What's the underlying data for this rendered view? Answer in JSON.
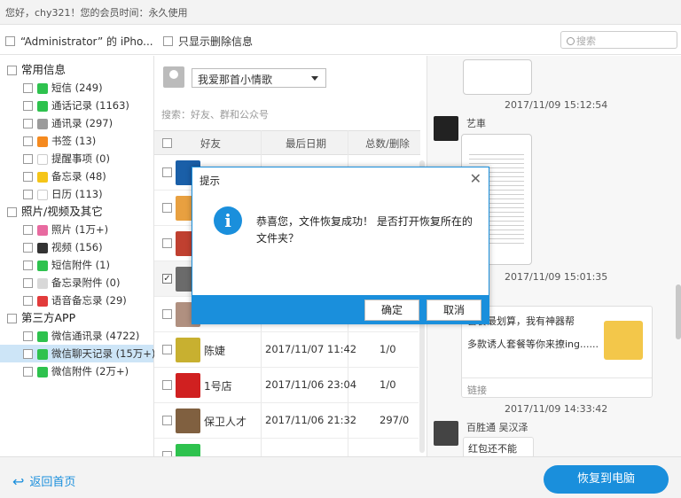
{
  "topbar": {
    "greeting": "您好，chy321！您的会员时间：永久使用"
  },
  "toolbar": {
    "device_label": "“Administrator” 的 iPho...",
    "only_deleted_label": "只显示删除信息",
    "search_placeholder": "搜索"
  },
  "tree": {
    "categories": [
      {
        "label": "常用信息",
        "items": [
          {
            "label": "短信 (249)",
            "icon": "message-icon",
            "color": "#2ec24e"
          },
          {
            "label": "通话记录 (1163)",
            "icon": "phone-icon",
            "color": "#2ec24e"
          },
          {
            "label": "通讯录 (297)",
            "icon": "contacts-icon",
            "color": "#9b9b9b"
          },
          {
            "label": "书签 (13)",
            "icon": "bookmark-icon",
            "color": "#f58a1f"
          },
          {
            "label": "提醒事项 (0)",
            "icon": "reminder-icon",
            "color": "#e0e0e0"
          },
          {
            "label": "备忘录 (48)",
            "icon": "notes-icon",
            "color": "#f5c518"
          },
          {
            "label": "日历 (113)",
            "icon": "calendar-icon",
            "color": "#e8e8e8"
          }
        ]
      },
      {
        "label": "照片/视频及其它",
        "items": [
          {
            "label": "照片 (1万+)",
            "icon": "photos-icon",
            "color": "#e86aa0"
          },
          {
            "label": "视频 (156)",
            "icon": "video-icon",
            "color": "#333333"
          },
          {
            "label": "短信附件 (1)",
            "icon": "attachment-icon",
            "color": "#2ec24e"
          },
          {
            "label": "备忘录附件 (0)",
            "icon": "notes-attachment-icon",
            "color": "#d8d8d8"
          },
          {
            "label": "语音备忘录 (29)",
            "icon": "voice-memo-icon",
            "color": "#e23b3b"
          }
        ]
      },
      {
        "label": "第三方APP",
        "items": [
          {
            "label": "微信通讯录 (4722)",
            "icon": "wechat-contacts-icon",
            "color": "#2ec24e"
          },
          {
            "label": "微信聊天记录 (15万+)",
            "icon": "wechat-chat-icon",
            "color": "#2ec24e"
          },
          {
            "label": "微信附件 (2万+)",
            "icon": "wechat-attachment-icon",
            "color": "#2ec24e"
          }
        ]
      }
    ]
  },
  "chatlist": {
    "account": "我爱那首小情歌",
    "search_placeholder": "搜索：好友、群和公众号",
    "headers": {
      "friend": "好友",
      "last_date": "最后日期",
      "total_deleted": "总数/删除"
    },
    "rows": [
      {
        "name": "",
        "date": "",
        "count": "",
        "checked": false,
        "color": "#1a5fa8"
      },
      {
        "name": "",
        "date": "",
        "count": "",
        "checked": false,
        "color": "#e8a040"
      },
      {
        "name": "",
        "date": "",
        "count": "",
        "checked": false,
        "color": "#c04030"
      },
      {
        "name": "",
        "date": "",
        "count": "",
        "checked": true,
        "color": "#6b6b6b"
      },
      {
        "name": "",
        "date": "",
        "count": "",
        "checked": false,
        "color": "#b09080"
      },
      {
        "name": "陈婕",
        "date": "2017/11/07 11:42",
        "count": "1/0",
        "checked": false,
        "color": "#c8b030"
      },
      {
        "name": "1号店",
        "date": "2017/11/06 23:04",
        "count": "1/0",
        "checked": false,
        "color": "#d02020"
      },
      {
        "name": "保卫人才",
        "date": "2017/11/06 21:32",
        "count": "297/0",
        "checked": false,
        "color": "#806040"
      },
      {
        "name": "",
        "date": "",
        "count": "",
        "checked": false,
        "color": "#2ec24e"
      }
    ]
  },
  "chat": {
    "timestamps": [
      "2017/11/09 15:12:54",
      "2017/11/09 15:01:35",
      "2017/11/09 14:33:42"
    ],
    "sender_1": "艺車",
    "link_text_1": "套餐最划算，我有神器帮",
    "link_text_2": "多款诱人套餐等你来撩ing......",
    "link_label": "链接",
    "sender_2": "百胜通  吴汉泽",
    "bubble_text": "红包还不能选..."
  },
  "footer": {
    "back_label": "返回首页",
    "restore_label": "恢复到电脑"
  },
  "dialog": {
    "title": "提示",
    "message": "恭喜您，文件恢复成功！ 是否打开恢复所在的文件夹？",
    "ok_label": "确定",
    "cancel_label": "取消"
  },
  "colors": {
    "accent": "#1a8fdc",
    "selected_row": "#cde5f7"
  }
}
